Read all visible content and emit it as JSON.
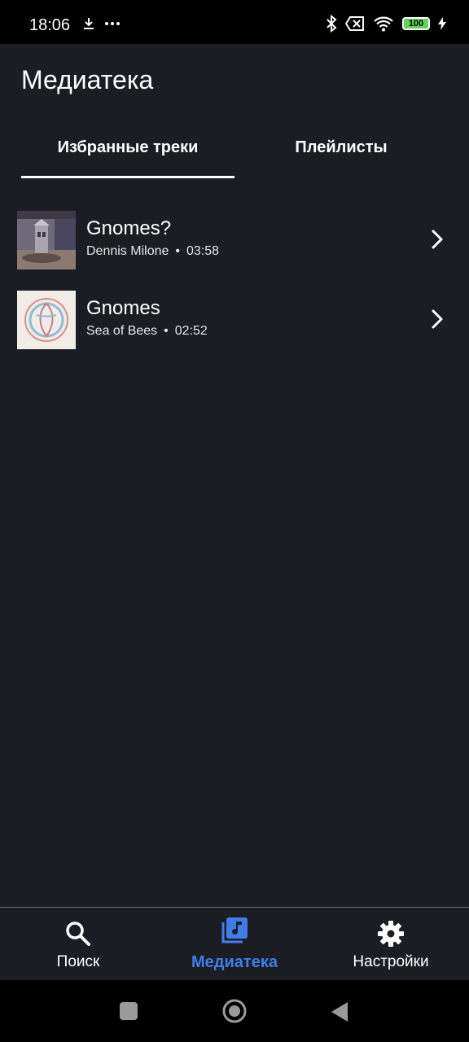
{
  "status_bar": {
    "time": "18:06",
    "battery": "100"
  },
  "header": {
    "title": "Медиатека"
  },
  "tabs": [
    {
      "label": "Избранные треки",
      "active": true
    },
    {
      "label": "Плейлисты",
      "active": false
    }
  ],
  "tracks": [
    {
      "title": "Gnomes?",
      "artist": "Dennis Milone",
      "duration": "03:58"
    },
    {
      "title": "Gnomes",
      "artist": "Sea of Bees",
      "duration": "02:52"
    }
  ],
  "bottom_nav": [
    {
      "label": "Поиск",
      "icon": "search-icon",
      "active": false
    },
    {
      "label": "Медиатека",
      "icon": "library-music-icon",
      "active": true
    },
    {
      "label": "Настройки",
      "icon": "gear-icon",
      "active": false
    }
  ],
  "colors": {
    "accent": "#3f7ee8",
    "background": "#1c1c24"
  }
}
